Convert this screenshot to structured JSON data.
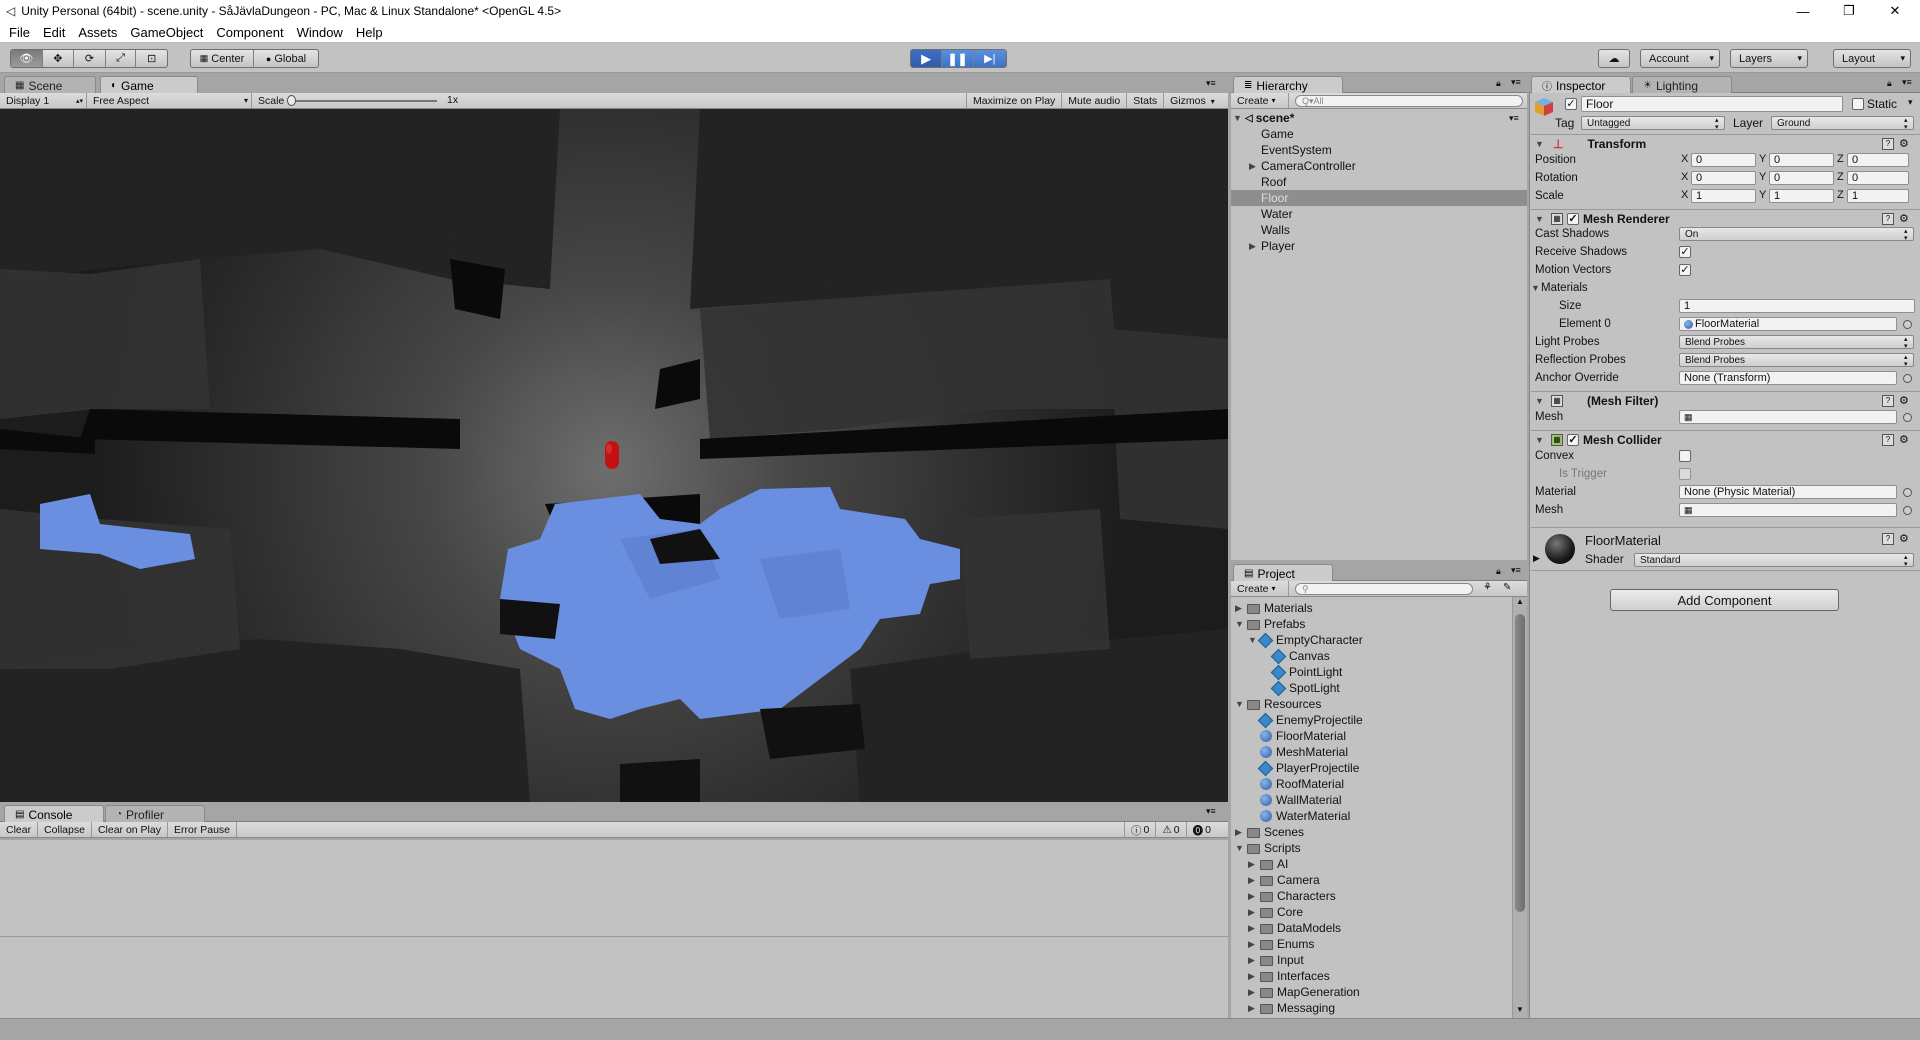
{
  "window": {
    "title": "Unity Personal (64bit) - scene.unity - SåJävlaDungeon - PC, Mac & Linux Standalone* <OpenGL 4.5>",
    "min_glyph": "—",
    "max_glyph": "❐",
    "close_glyph": "✕"
  },
  "menu": [
    "File",
    "Edit",
    "Assets",
    "GameObject",
    "Component",
    "Window",
    "Help"
  ],
  "toolbar": {
    "pivot_center": "Center",
    "pivot_global": "Global",
    "account": "Account",
    "layers": "Layers",
    "layout": "Layout"
  },
  "scene_tabs": {
    "scene": "Scene",
    "game": "Game"
  },
  "game_bar": {
    "display": "Display 1",
    "aspect": "Free Aspect",
    "scale_label": "Scale",
    "scale_value": "1x",
    "maximize": "Maximize on Play",
    "mute": "Mute audio",
    "stats": "Stats",
    "gizmos": "Gizmos"
  },
  "console": {
    "tab": "Console",
    "profiler_tab": "Profiler",
    "clear": "Clear",
    "collapse": "Collapse",
    "clear_on_play": "Clear on Play",
    "error_pause": "Error Pause",
    "log_count": "0",
    "warn_count": "0",
    "error_count": "0"
  },
  "hierarchy": {
    "tab": "Hierarchy",
    "create": "Create",
    "search_placeholder": "Q▾All",
    "scene_name": "scene*",
    "items": [
      {
        "label": "Game",
        "expandable": false,
        "selected": false
      },
      {
        "label": "EventSystem",
        "expandable": false,
        "selected": false
      },
      {
        "label": "CameraController",
        "expandable": true,
        "selected": false
      },
      {
        "label": "Roof",
        "expandable": false,
        "selected": false
      },
      {
        "label": "Floor",
        "expandable": false,
        "selected": true
      },
      {
        "label": "Water",
        "expandable": false,
        "selected": false
      },
      {
        "label": "Walls",
        "expandable": false,
        "selected": false
      },
      {
        "label": "Player",
        "expandable": true,
        "selected": false
      }
    ]
  },
  "project": {
    "tab": "Project",
    "create": "Create",
    "tree": [
      {
        "label": "Materials",
        "type": "folder",
        "depth": 0,
        "arrow": "▶"
      },
      {
        "label": "Prefabs",
        "type": "folder",
        "depth": 0,
        "arrow": "▼"
      },
      {
        "label": "EmptyCharacter",
        "type": "prefab",
        "depth": 1,
        "arrow": "▼"
      },
      {
        "label": "Canvas",
        "type": "prefab",
        "depth": 2,
        "arrow": ""
      },
      {
        "label": "PointLight",
        "type": "prefab",
        "depth": 2,
        "arrow": ""
      },
      {
        "label": "SpotLight",
        "type": "prefab",
        "depth": 2,
        "arrow": ""
      },
      {
        "label": "Resources",
        "type": "folder",
        "depth": 0,
        "arrow": "▼"
      },
      {
        "label": "EnemyProjectile",
        "type": "prefab",
        "depth": 1,
        "arrow": ""
      },
      {
        "label": "FloorMaterial",
        "type": "material",
        "depth": 1,
        "arrow": ""
      },
      {
        "label": "MeshMaterial",
        "type": "material",
        "depth": 1,
        "arrow": ""
      },
      {
        "label": "PlayerProjectile",
        "type": "prefab",
        "depth": 1,
        "arrow": ""
      },
      {
        "label": "RoofMaterial",
        "type": "material",
        "depth": 1,
        "arrow": ""
      },
      {
        "label": "WallMaterial",
        "type": "material",
        "depth": 1,
        "arrow": ""
      },
      {
        "label": "WaterMaterial",
        "type": "material",
        "depth": 1,
        "arrow": ""
      },
      {
        "label": "Scenes",
        "type": "folder",
        "depth": 0,
        "arrow": "▶"
      },
      {
        "label": "Scripts",
        "type": "folder",
        "depth": 0,
        "arrow": "▼"
      },
      {
        "label": "AI",
        "type": "folder",
        "depth": 1,
        "arrow": "▶"
      },
      {
        "label": "Camera",
        "type": "folder",
        "depth": 1,
        "arrow": "▶"
      },
      {
        "label": "Characters",
        "type": "folder",
        "depth": 1,
        "arrow": "▶"
      },
      {
        "label": "Core",
        "type": "folder",
        "depth": 1,
        "arrow": "▶"
      },
      {
        "label": "DataModels",
        "type": "folder",
        "depth": 1,
        "arrow": "▶"
      },
      {
        "label": "Enums",
        "type": "folder",
        "depth": 1,
        "arrow": "▶"
      },
      {
        "label": "Input",
        "type": "folder",
        "depth": 1,
        "arrow": "▶"
      },
      {
        "label": "Interfaces",
        "type": "folder",
        "depth": 1,
        "arrow": "▶"
      },
      {
        "label": "MapGeneration",
        "type": "folder",
        "depth": 1,
        "arrow": "▶"
      },
      {
        "label": "Messaging",
        "type": "folder",
        "depth": 1,
        "arrow": "▶"
      }
    ]
  },
  "inspector": {
    "tab": "Inspector",
    "lighting_tab": "Lighting",
    "object_name": "Floor",
    "static_label": "Static",
    "tag_label": "Tag",
    "tag_value": "Untagged",
    "layer_label": "Layer",
    "layer_value": "Ground",
    "transform": {
      "title": "Transform",
      "position_label": "Position",
      "rotation_label": "Rotation",
      "scale_label": "Scale",
      "position": [
        "0",
        "0",
        "0"
      ],
      "rotation": [
        "0",
        "0",
        "0"
      ],
      "scale": [
        "1",
        "1",
        "1"
      ],
      "x": "X",
      "y": "Y",
      "z": "Z"
    },
    "mesh_renderer": {
      "title": "Mesh Renderer",
      "cast_shadows_label": "Cast Shadows",
      "cast_shadows_value": "On",
      "receive_shadows_label": "Receive Shadows",
      "motion_vectors_label": "Motion Vectors",
      "materials_label": "Materials",
      "size_label": "Size",
      "size_value": "1",
      "element0_label": "Element 0",
      "element0_value": "FloorMaterial",
      "light_probes_label": "Light Probes",
      "light_probes_value": "Blend Probes",
      "reflection_probes_label": "Reflection Probes",
      "reflection_probes_value": "Blend Probes",
      "anchor_override_label": "Anchor Override",
      "anchor_override_value": "None (Transform)"
    },
    "mesh_filter": {
      "title": "(Mesh Filter)",
      "mesh_label": "Mesh"
    },
    "mesh_collider": {
      "title": "Mesh Collider",
      "convex_label": "Convex",
      "is_trigger_label": "Is Trigger",
      "material_label": "Material",
      "material_value": "None (Physic Material)",
      "mesh_label": "Mesh"
    },
    "material": {
      "name": "FloorMaterial",
      "shader_label": "Shader",
      "shader_value": "Standard"
    },
    "add_component": "Add Component"
  },
  "colors": {
    "water": "#6a8fe0",
    "player": "#c41010",
    "editor_bg": "#c2c2c2",
    "selection": "#8e8e8e"
  }
}
